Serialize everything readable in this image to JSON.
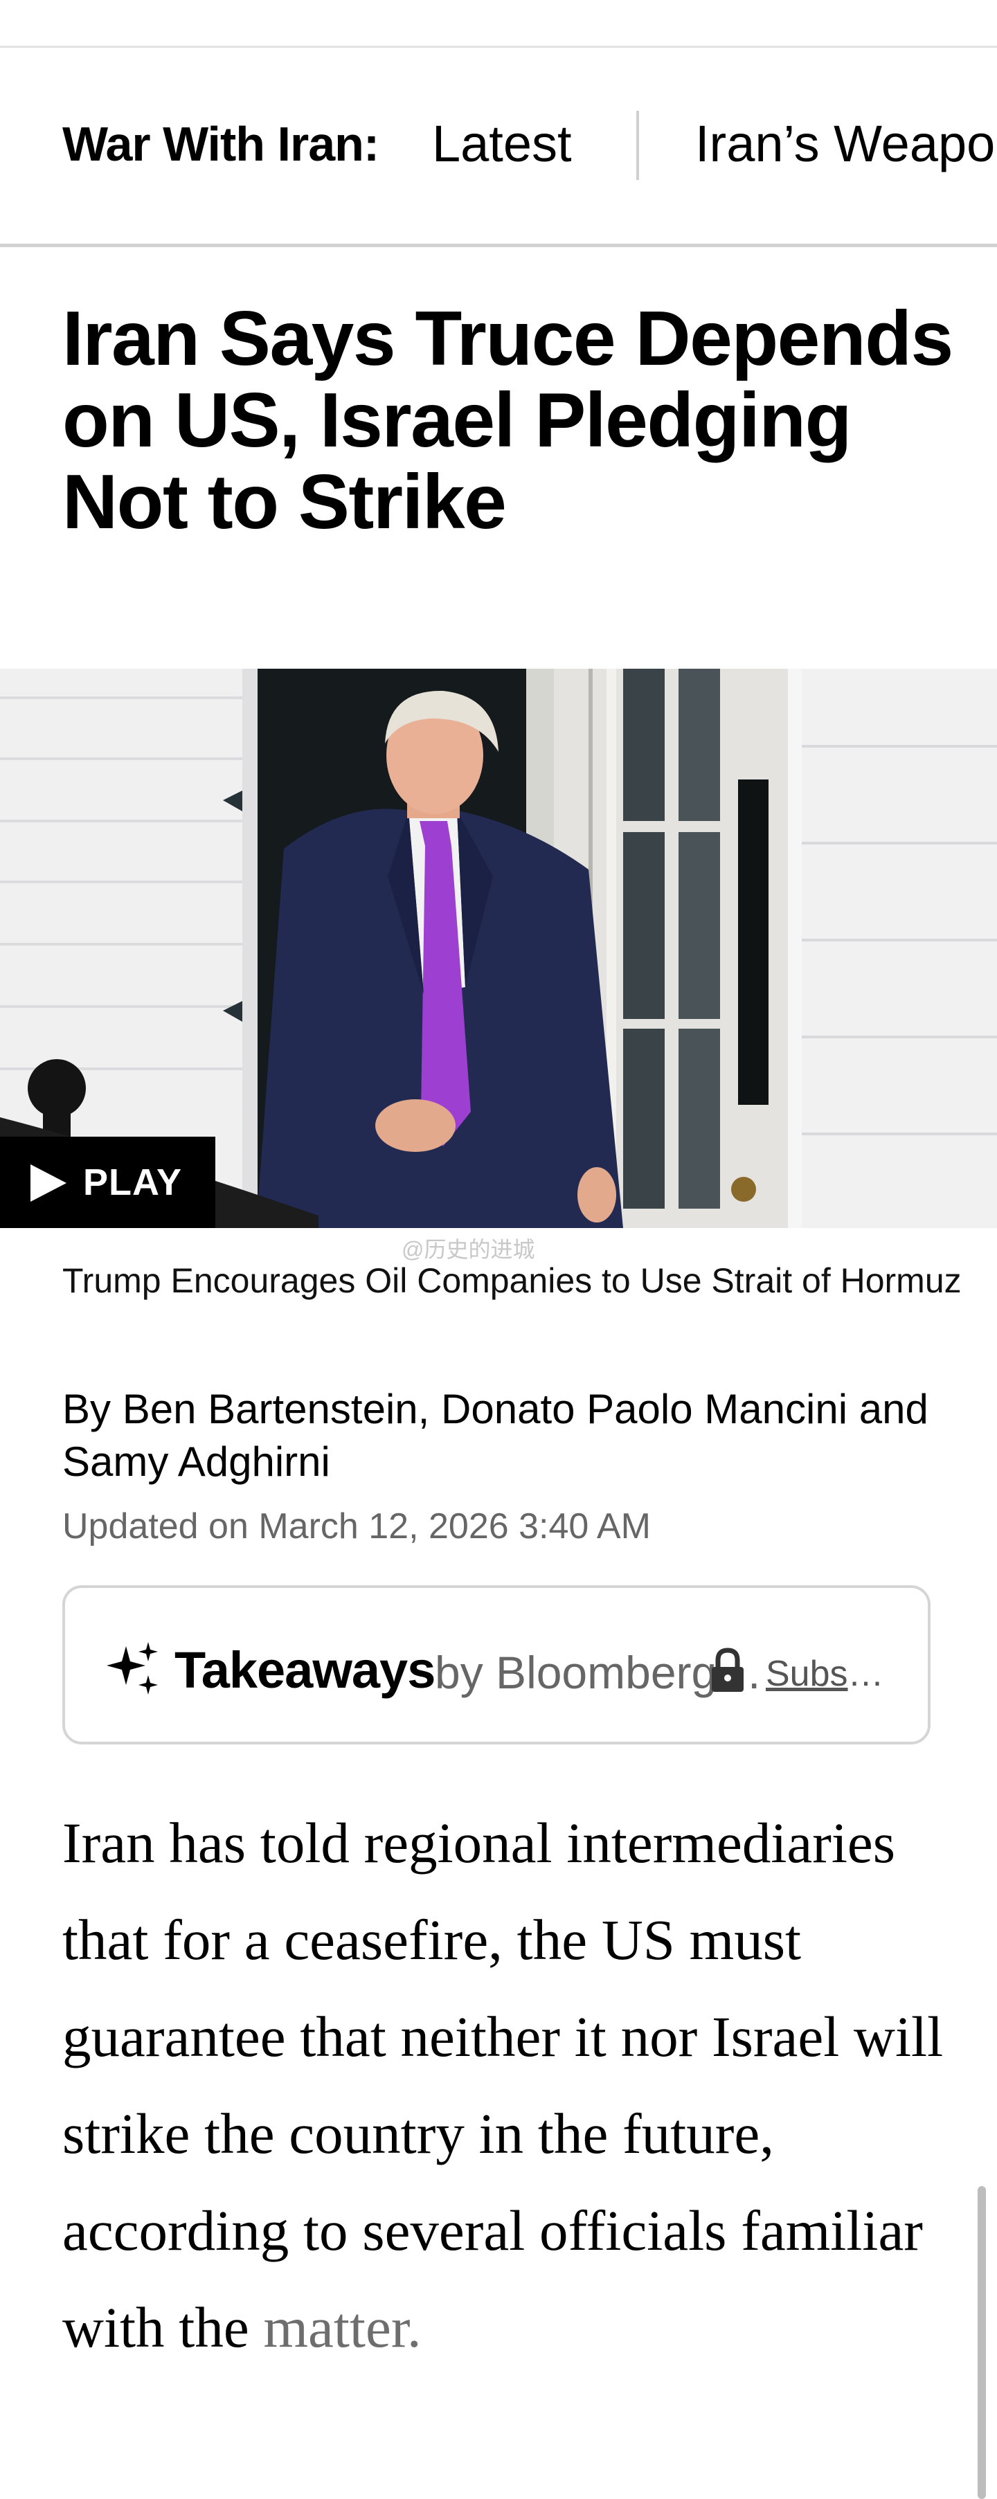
{
  "topic_nav": {
    "label": "War With Iran:",
    "links": [
      "Latest",
      "Iran’s Weapons"
    ]
  },
  "headline": "Iran Says Truce Depends on US, Israel Pledging Not to Strike",
  "media": {
    "play_label": "PLAY",
    "caption": "Trump Encourages Oil Companies to Use Strait of Hormuz",
    "watermark": "@历史的进城"
  },
  "byline": {
    "prefix": "By ",
    "author_1": "Ben Bartenstein",
    "separator": ", ",
    "author_2": "Donato Paolo Mancini",
    "conjunction": " and ",
    "author_3": "Samy Adghirni"
  },
  "updated": "Updated on March 12, 2026 3:40 AM",
  "takeaways": {
    "title": "Takeaways",
    "by": "by Bloomberg AI",
    "subscribe": "Subscribe",
    "icons": [
      "sparkle-icon",
      "lock-icon"
    ]
  },
  "article": {
    "paragraph_main": "Iran has told regional intermediaries that for a ceasefire, the US must guarantee that neither it nor Israel will strike the country in the future, according to several officials familiar with the",
    "paragraph_tail": "matter."
  },
  "colors": {
    "text": "#000000",
    "muted": "#666666",
    "border": "#d5d5d5",
    "tie_purple": "#9d3fd0",
    "suit_navy": "#232a52"
  }
}
